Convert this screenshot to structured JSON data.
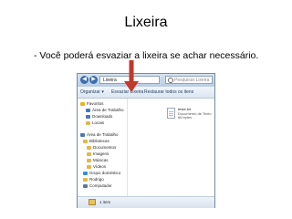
{
  "slide": {
    "title": "Lixeira",
    "bullet": "- Você poderá esvaziar a lixeira se achar necessário."
  },
  "explorer": {
    "address": "Lixeira",
    "search_placeholder": "Pesquisar Lixeira",
    "toolbar": {
      "organize": "Organizar ▾",
      "empty": "Esvaziar Lixeira",
      "restore": "Restaurar todos os itens"
    },
    "sidebar": [
      {
        "label": "Favoritos",
        "icon": "star-icon",
        "color": "#e8b420"
      },
      {
        "label": "Área de Trabalho",
        "icon": "desktop-icon",
        "color": "#4a78b8"
      },
      {
        "label": "Downloads",
        "icon": "download-icon",
        "color": "#4a78b8"
      },
      {
        "label": "Locais",
        "icon": "folder-icon",
        "color": "#e3b64c"
      },
      {
        "label": "Área de Trabalho",
        "icon": "desktop-icon",
        "color": "#4a78b8"
      },
      {
        "label": "Bibliotecas",
        "icon": "library-icon",
        "color": "#e3b64c"
      },
      {
        "label": "Documentos",
        "icon": "documents-icon",
        "color": "#e3b64c"
      },
      {
        "label": "Imagens",
        "icon": "pictures-icon",
        "color": "#e3b64c"
      },
      {
        "label": "Músicas",
        "icon": "music-icon",
        "color": "#e3b64c"
      },
      {
        "label": "Vídeos",
        "icon": "videos-icon",
        "color": "#e3b64c"
      },
      {
        "label": "Grupo doméstico",
        "icon": "homegroup-icon",
        "color": "#3e8fd0"
      },
      {
        "label": "Rodrigo",
        "icon": "user-icon",
        "color": "#e3b64c"
      },
      {
        "label": "Computador",
        "icon": "computer-icon",
        "color": "#5a7aa0"
      }
    ],
    "file": {
      "name": "teste.txt",
      "type": "Documento de Texto",
      "size": "66 bytes"
    },
    "status": "1 item"
  },
  "colors": {
    "arrow": "#c0392b"
  }
}
